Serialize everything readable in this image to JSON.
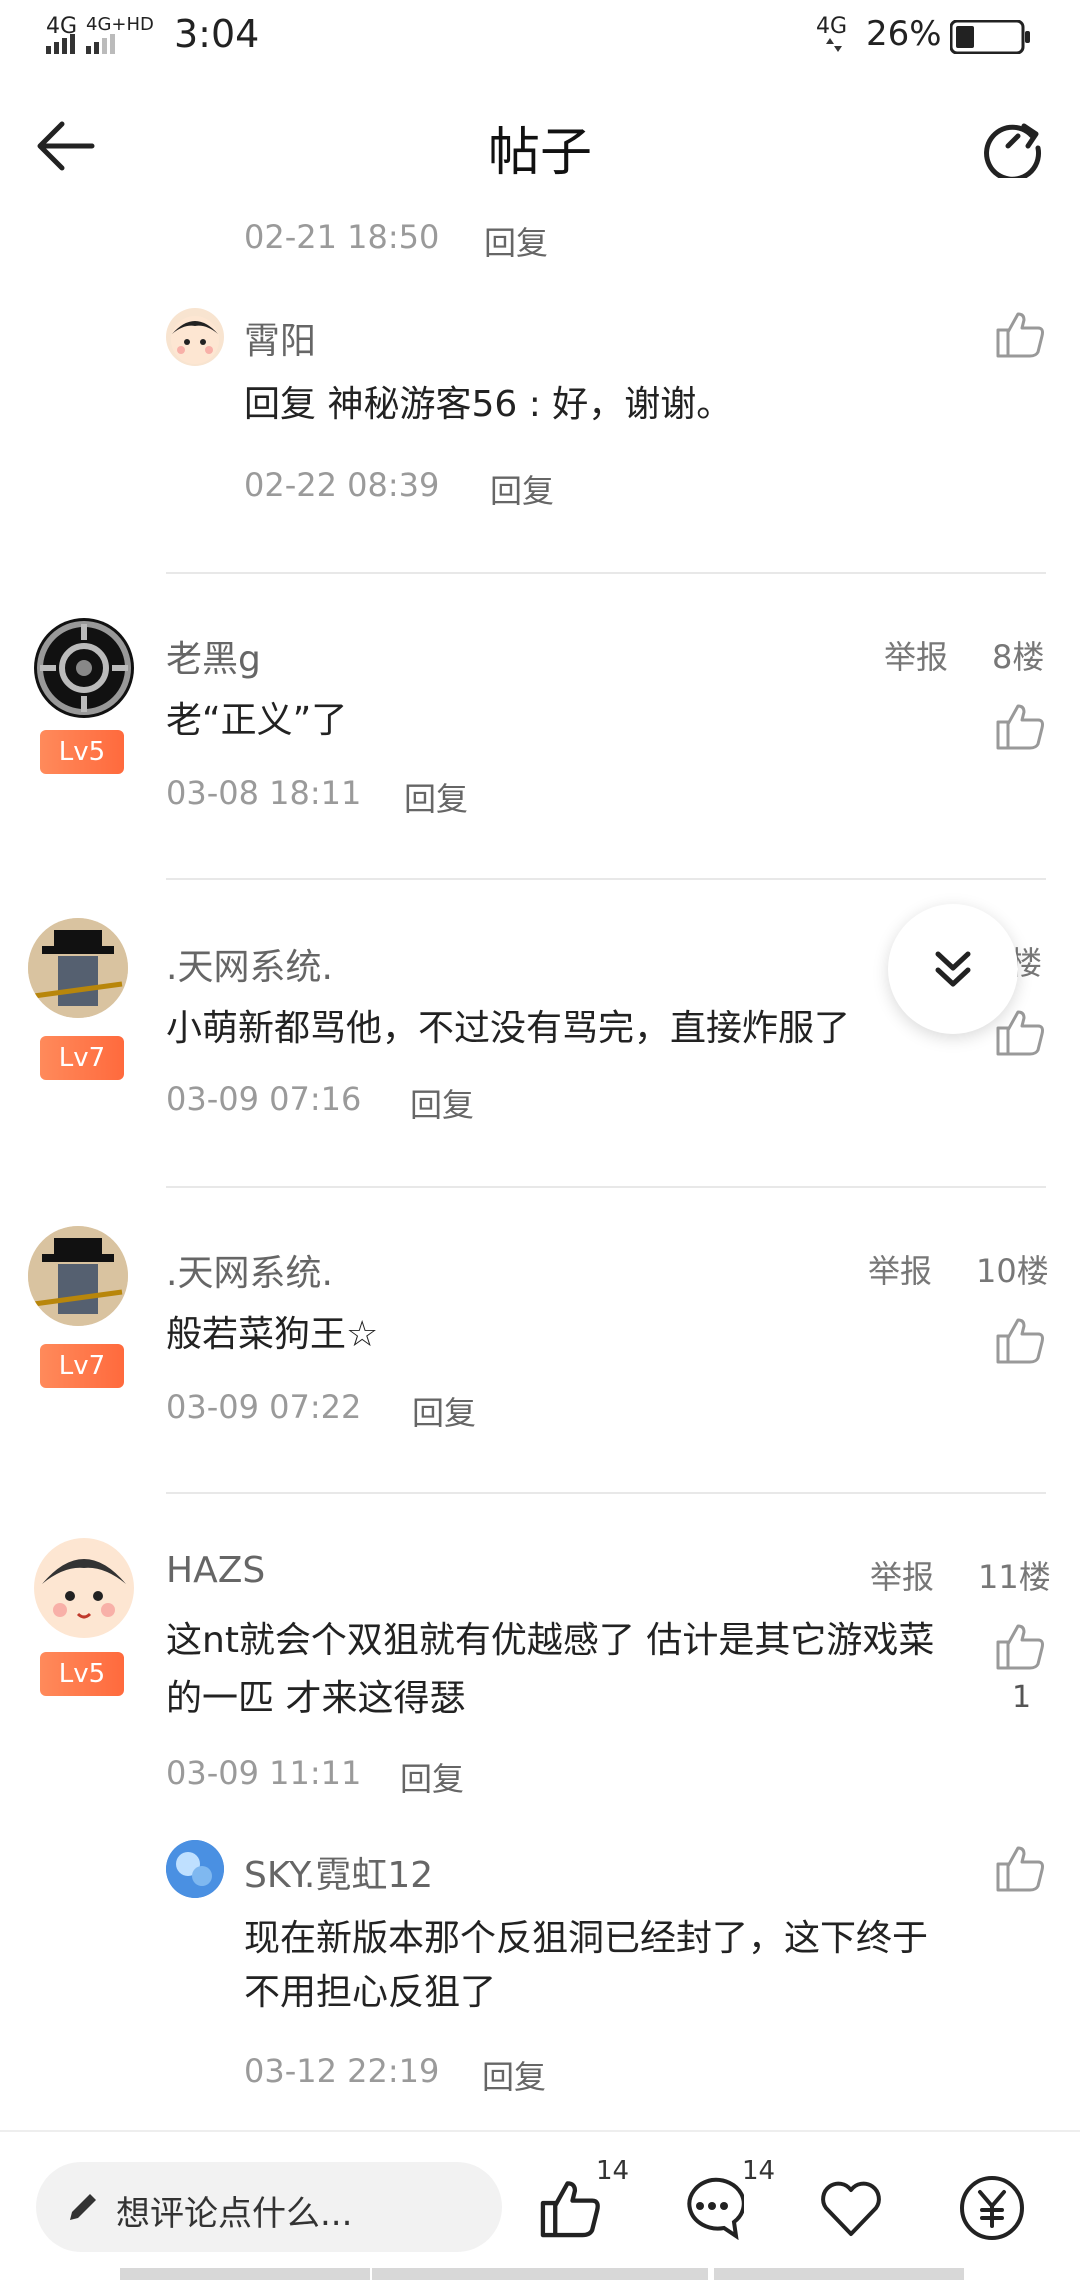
{
  "status_bar": {
    "network_left": "4G",
    "network_left2": "4G+HD",
    "time": "3:04",
    "network_right": "4G",
    "battery": "26%"
  },
  "header": {
    "title": "帖子",
    "back_icon": "back-arrow-icon",
    "refresh_icon": "refresh-icon"
  },
  "top_partial": {
    "time": "02-21 18:50",
    "reply_label": "回复"
  },
  "sub_reply_1": {
    "name": "霄阳",
    "content": "回复 神秘游客56 : 好，谢谢。",
    "time": "02-22 08:39",
    "reply_label": "回复"
  },
  "posts": [
    {
      "name": "老黑g",
      "level": "Lv5",
      "report": "举报",
      "floor": "8楼",
      "content": "老“正义”了",
      "time": "03-08 18:11",
      "reply_label": "回复"
    },
    {
      "name": ".天网系统.",
      "level": "Lv7",
      "floor": "楼",
      "content": "小萌新都骂他，不过没有骂完，直接炸服了",
      "time": "03-09 07:16",
      "reply_label": "回复"
    },
    {
      "name": ".天网系统.",
      "level": "Lv7",
      "report": "举报",
      "floor": "10楼",
      "content": "般若菜狗王☆",
      "time": "03-09 07:22",
      "reply_label": "回复"
    },
    {
      "name": "HAZS",
      "level": "Lv5",
      "report": "举报",
      "floor": "11楼",
      "content_line1": "这nt就会个双狙就有优越感了 估计是其它游戏菜",
      "content_line2": "的一匹 才来这得瑟",
      "time": "03-09 11:11",
      "reply_label": "回复",
      "likes": "1"
    }
  ],
  "sub_reply_2": {
    "name": "SKY.霓虹12",
    "content_line1": "现在新版本那个反狙洞已经封了，这下终于",
    "content_line2": "不用担心反狙了",
    "time": "03-12 22:19",
    "reply_label": "回复"
  },
  "bottom_bar": {
    "comment_placeholder": "想评论点什么...",
    "like_count": "14",
    "comment_count": "14",
    "icons": [
      "pencil-icon",
      "thumbs-up-icon",
      "comment-icon",
      "heart-icon",
      "yuan-icon"
    ]
  },
  "colors": {
    "level_badge": "#ff7a4d",
    "divider": "#e8e8e8",
    "text_muted": "#9a9a9a"
  }
}
